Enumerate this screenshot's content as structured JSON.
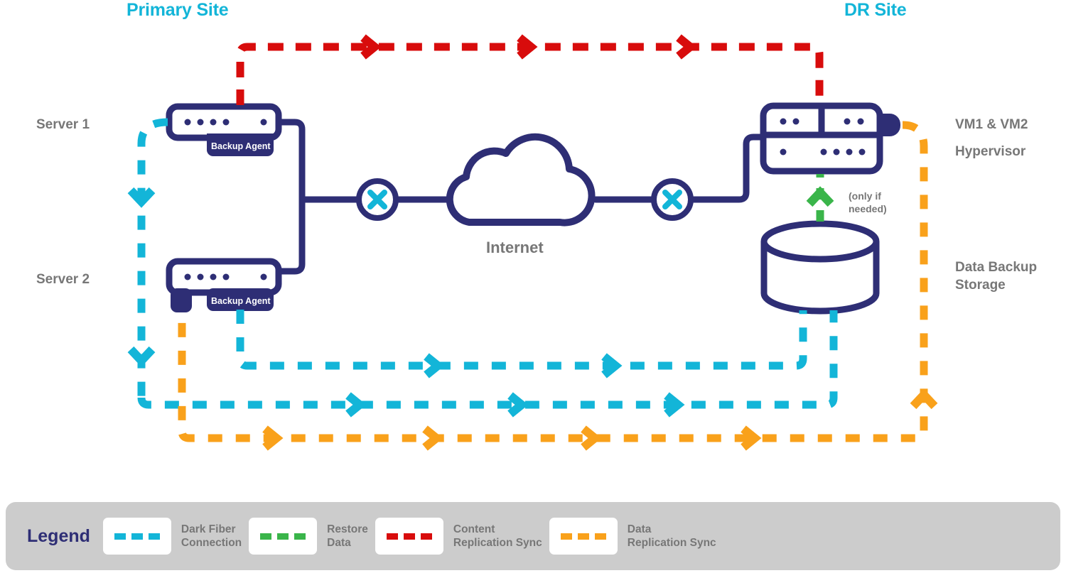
{
  "diagram": {
    "title_primary": "Primary Site",
    "title_dr": "DR Site",
    "accent_cyan": "#13b5d8",
    "navy": "#2e2e75",
    "grey_label": "#777777",
    "red": "#d80c0c",
    "green": "#3ab54a",
    "orange": "#f9a11b",
    "legend_bg": "#cccccc"
  },
  "nodes": {
    "server1_label": "Server 1",
    "server2_label": "Server 2",
    "backup_agent_1": "Backup Agent",
    "backup_agent_2": "Backup Agent",
    "internet_label": "Internet",
    "vm_label": "VM1 & VM2",
    "hypervisor_label": "Hypervisor",
    "storage_label": "Data Backup\nStorage",
    "only_if_needed": "(only if\nneeded)"
  },
  "legend": {
    "title": "Legend",
    "items": [
      {
        "label": "Dark Fiber\nConnection",
        "color": "#13b5d8",
        "name": "dark-fiber-connection"
      },
      {
        "label": "Restore\nData",
        "color": "#3ab54a",
        "name": "restore-data"
      },
      {
        "label": "Content\nReplication Sync",
        "color": "#d80c0c",
        "name": "content-replication-sync"
      },
      {
        "label": "Data\nReplication Sync",
        "color": "#f9a11b",
        "name": "data-replication-sync"
      }
    ]
  }
}
